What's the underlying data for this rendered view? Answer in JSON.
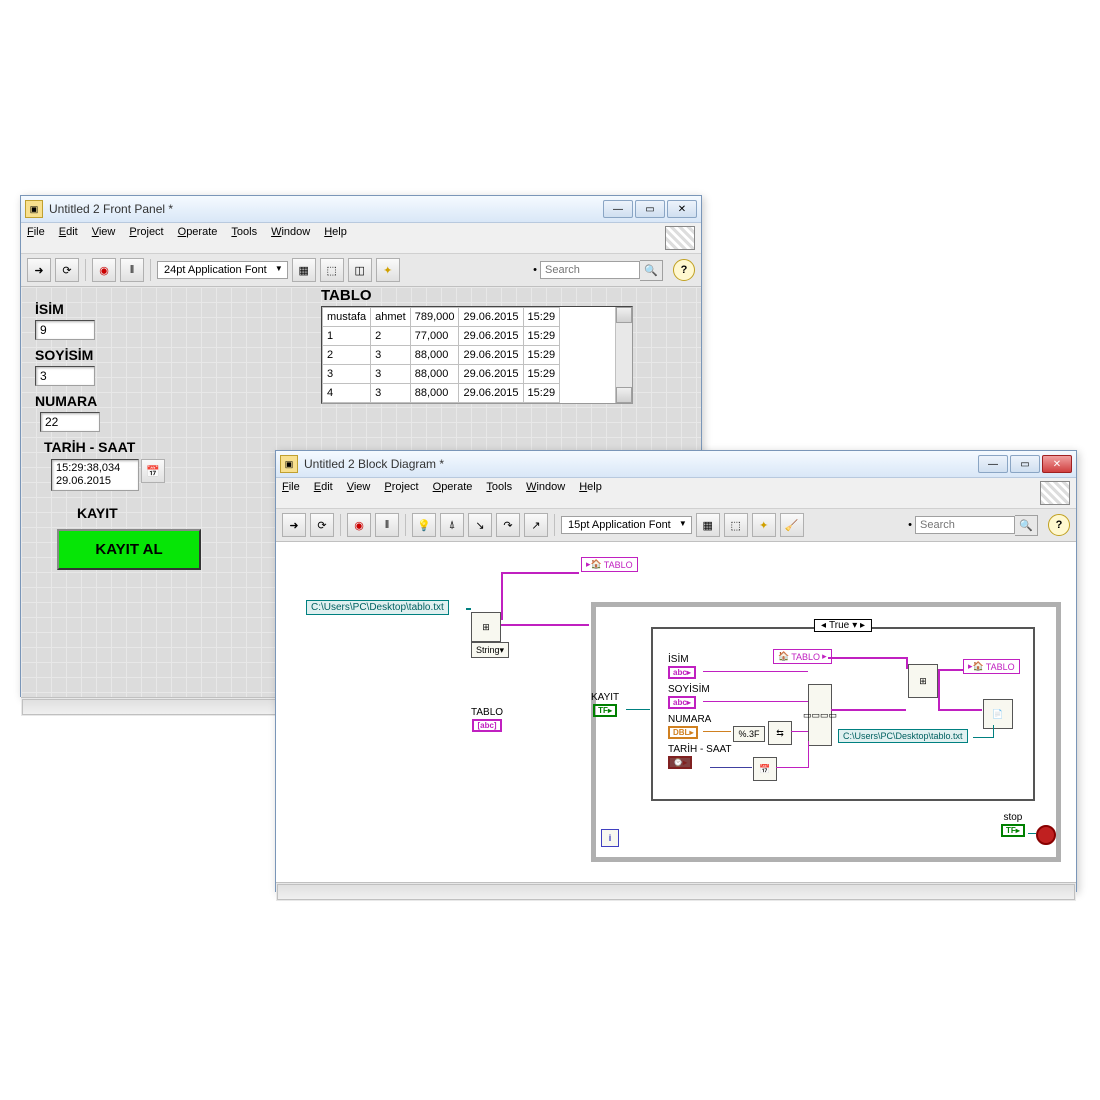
{
  "front_panel": {
    "title": "Untitled 2 Front Panel *",
    "menu": [
      "File",
      "Edit",
      "View",
      "Project",
      "Operate",
      "Tools",
      "Window",
      "Help"
    ],
    "font": "24pt Application Font",
    "search_placeholder": "Search",
    "labels": {
      "isim": "İSİM",
      "soyisim": "SOYİSİM",
      "numara": "NUMARA",
      "tarih": "TARİH - SAAT",
      "kayit": "KAYIT",
      "kayit_btn": "KAYIT AL",
      "tablo": "TABLO"
    },
    "values": {
      "isim": "9",
      "soyisim": "3",
      "numara": "22",
      "tarih_time": "15:29:38,034",
      "tarih_date": "29.06.2015"
    },
    "table": {
      "rows": [
        [
          "mustafa",
          "ahmet",
          "789,000",
          "29.06.2015",
          "15:29"
        ],
        [
          "1",
          "2",
          "77,000",
          "29.06.2015",
          "15:29"
        ],
        [
          "2",
          "3",
          "88,000",
          "29.06.2015",
          "15:29"
        ],
        [
          "3",
          "3",
          "88,000",
          "29.06.2015",
          "15:29"
        ],
        [
          "4",
          "3",
          "88,000",
          "29.06.2015",
          "15:29"
        ]
      ]
    }
  },
  "block_diagram": {
    "title": "Untitled 2 Block Diagram *",
    "menu": [
      "File",
      "Edit",
      "View",
      "Project",
      "Operate",
      "Tools",
      "Window",
      "Help"
    ],
    "font": "15pt Application Font",
    "search_placeholder": "Search",
    "filepath": "C:\\Users\\PC\\Desktop\\tablo.txt",
    "case_label": "True",
    "stop_label": "stop",
    "tablo_ref": "TABLO",
    "string_sel": "String",
    "format_spec": "%.3F",
    "tablo_indicator": "TABLO",
    "terminals": {
      "isim": "İSİM",
      "soyisim": "SOYİSİM",
      "numara": "NUMARA",
      "tarih": "TARİH - SAAT",
      "kayit": "KAYIT"
    }
  }
}
